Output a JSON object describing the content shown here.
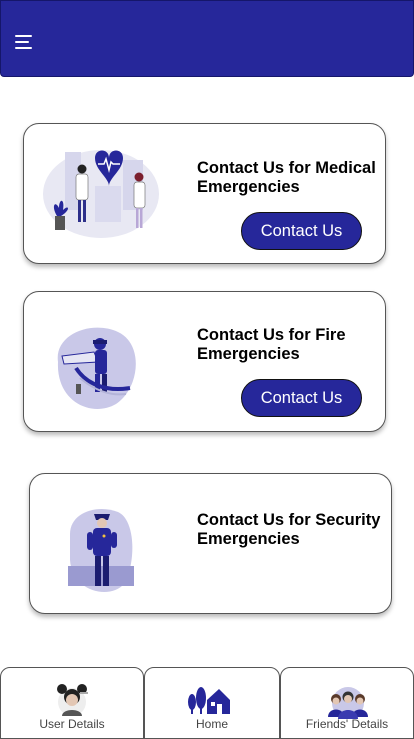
{
  "header": {
    "menu_icon": "hamburger-menu-icon",
    "background": "#26279a"
  },
  "cards": [
    {
      "title": "Contact Us for Medical Emergencies",
      "button_label": "Contact Us",
      "illustration": "doctors-heart-illustration"
    },
    {
      "title": "Contact Us for Fire Emergencies",
      "button_label": "Contact Us",
      "illustration": "firefighter-illustration"
    },
    {
      "title": "Contact Us for Security Emergencies",
      "illustration": "police-officer-illustration"
    }
  ],
  "bottom_nav": [
    {
      "label": "User Details",
      "icon": "user-avatar-icon"
    },
    {
      "label": "Home",
      "icon": "home-icon"
    },
    {
      "label": "Friends' Details",
      "icon": "friends-group-icon"
    }
  ],
  "colors": {
    "primary": "#26279a",
    "card_border": "#555555",
    "illustration_lavender": "#c9c8e8"
  }
}
